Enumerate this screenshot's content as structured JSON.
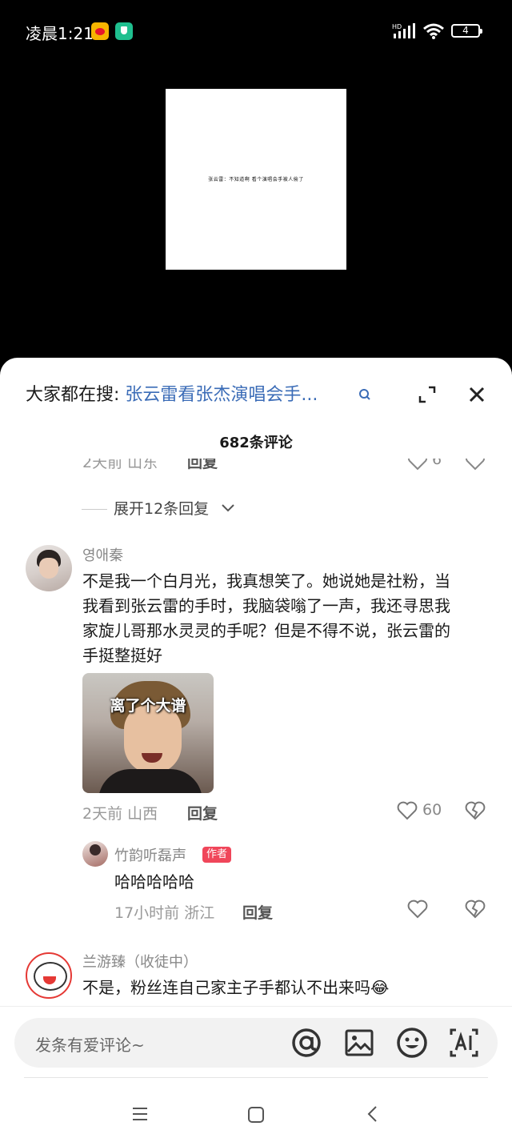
{
  "status_bar": {
    "time": "凌晨1:21",
    "battery": "4",
    "network": "HD"
  },
  "video": {
    "caption": "张云雷：不知道啊 看个演唱会手被人偷了"
  },
  "header": {
    "search_prefix": "大家都在搜:",
    "search_term": "张云雷看张杰演唱会手...",
    "comment_count": "682条评论"
  },
  "prev_comment": {
    "time_location": "2天前 山东",
    "reply": "回复",
    "likes": "6"
  },
  "expand": {
    "label": "展开12条回复"
  },
  "comments": [
    {
      "username": "영애秦",
      "text_lines": [
        "不是我一个白月光，我真想笑了。她说她是社粉，当",
        "我看到张云雷的手时，我脑袋嗡了一声，我还寻思我",
        "家旋儿哥那水灵灵的手呢？但是不得不说，张云雷的",
        "手挺整挺好"
      ],
      "sticker_text": "离了个大谱",
      "time_location": "2天前 山西",
      "reply": "回复",
      "likes": "60",
      "reply_item": {
        "username": "竹韵听磊声",
        "badge": "作者",
        "text": "哈哈哈哈哈",
        "time_location": "17小时前 浙江",
        "reply": "回复"
      }
    },
    {
      "username": "兰游臻（收徒中）",
      "text": "不是，粉丝连自己家主子手都认不出来吗😂"
    }
  ],
  "composer": {
    "placeholder": "发条有爱评论~"
  }
}
